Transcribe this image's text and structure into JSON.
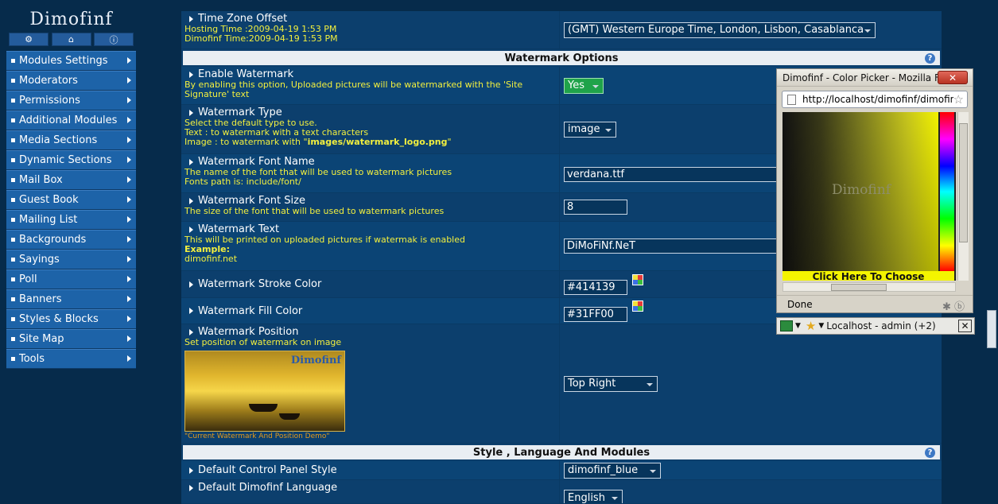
{
  "sidebar": {
    "logo": "Dimofinf",
    "icons": [
      "gear-icon",
      "home-icon",
      "info-icon"
    ],
    "items": [
      {
        "label": "Modules Settings"
      },
      {
        "label": "Moderators"
      },
      {
        "label": "Permissions"
      },
      {
        "label": "Additional Modules"
      },
      {
        "label": "Media Sections"
      },
      {
        "label": "Dynamic Sections"
      },
      {
        "label": "Mail Box"
      },
      {
        "label": "Guest Book"
      },
      {
        "label": "Mailing List"
      },
      {
        "label": "Backgrounds"
      },
      {
        "label": "Sayings"
      },
      {
        "label": "Poll"
      },
      {
        "label": "Banners"
      },
      {
        "label": "Styles & Blocks"
      },
      {
        "label": "Site Map"
      },
      {
        "label": "Tools"
      }
    ]
  },
  "timezone": {
    "title": "Time Zone Offset",
    "hosting_time": "Hosting Time :2009-04-19 1:53 PM",
    "dimofinf_time": "Dimofinf Time:2009-04-19 1:53 PM",
    "value": "(GMT) Western Europe Time, London, Lisbon, Casablanca"
  },
  "watermark_section": {
    "title": "Watermark Options"
  },
  "enable_watermark": {
    "title": "Enable Watermark",
    "desc": "By enabling this option, Uploaded pictures will be watermarked with the 'Site Signature' text",
    "value": "Yes"
  },
  "watermark_type": {
    "title": "Watermark Type",
    "desc1": "Select the default type to use.",
    "desc2": "Text : to watermark with a text characters",
    "desc3": "Image : to watermark with \"",
    "desc3_bold": "images/watermark_logo.png",
    "desc3_end": "\"",
    "value": "image"
  },
  "font_name": {
    "title": "Watermark Font Name",
    "desc1": "The name of the font that will be used to watermark pictures",
    "desc2": "Fonts path is: include/font/",
    "value": "verdana.ttf"
  },
  "font_size": {
    "title": "Watermark Font Size",
    "desc": "The size of the font that will be used to watermark pictures",
    "value": "8"
  },
  "watermark_text": {
    "title": "Watermark Text",
    "desc": "This will be printed on uploaded pictures if watermak is enabled",
    "example_label": "Example:",
    "example": "dimofinf.net",
    "value": "DiMoFiNf.NeT"
  },
  "stroke_color": {
    "title": "Watermark Stroke Color",
    "value": "#414139"
  },
  "fill_color": {
    "title": "Watermark Fill Color",
    "value": "#31FF00"
  },
  "position": {
    "title": "Watermark Position",
    "desc": "Set position of watermark on image",
    "image_watermark": "Dimofinf",
    "caption": "\"Current Watermark And Position Demo\"",
    "value": "Top Right"
  },
  "style_section": {
    "title": "Style , Language And Modules"
  },
  "cp_style": {
    "title": "Default Control Panel Style",
    "value": "dimofinf_blue"
  },
  "language": {
    "title": "Default Dimofinf Language",
    "value": "English"
  },
  "popup": {
    "title": "Dimofinf - Color Picker - Mozilla F...",
    "url": "http://localhost/dimofinf/dimofinf",
    "picker_logo": "Dimofinf",
    "button": "Click Here To Choose",
    "status": "Done"
  },
  "taskbar": {
    "label": "Localhost - admin (+2)"
  },
  "colors": {
    "accent": "#1d63a8",
    "desc_text": "#f2ef3e",
    "row_bg": "#0c3f6d",
    "page_bg": "#062b4b"
  }
}
